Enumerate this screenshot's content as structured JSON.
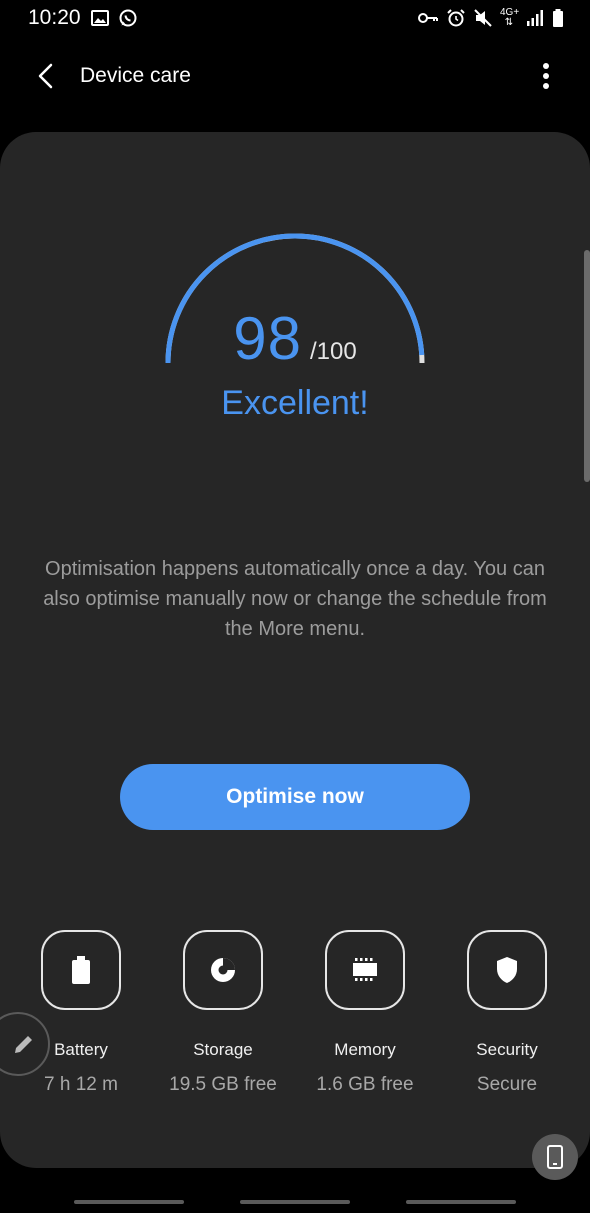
{
  "status_bar": {
    "time": "10:20",
    "network_label": "4G+",
    "left_icons": [
      "image-icon",
      "whatsapp-icon"
    ],
    "right_icons": [
      "vpn-key-icon",
      "alarm-icon",
      "mute-icon",
      "network-4g-icon",
      "signal-icon",
      "battery-icon"
    ]
  },
  "app_bar": {
    "title": "Device care",
    "back_icon": "back-arrow-icon",
    "more_icon": "more-vert-icon"
  },
  "score": {
    "value": "98",
    "max_label": "/100",
    "fraction": 0.98,
    "rating": "Excellent!"
  },
  "info_text": "Optimisation happens automatically once a day. You can also optimise manually now or change the schedule from the More menu.",
  "optimise_button": "Optimise now",
  "categories": [
    {
      "label": "Battery",
      "value": "7 h 12 m",
      "icon": "battery-icon"
    },
    {
      "label": "Storage",
      "value": "19.5 GB free",
      "icon": "storage-pie-icon"
    },
    {
      "label": "Memory",
      "value": "1.6 GB free",
      "icon": "memory-chip-icon"
    },
    {
      "label": "Security",
      "value": "Secure",
      "icon": "shield-icon"
    }
  ],
  "colors": {
    "accent": "#4a94f0",
    "background": "#000000",
    "card": "#262626",
    "text_secondary": "#9c9c9c"
  }
}
